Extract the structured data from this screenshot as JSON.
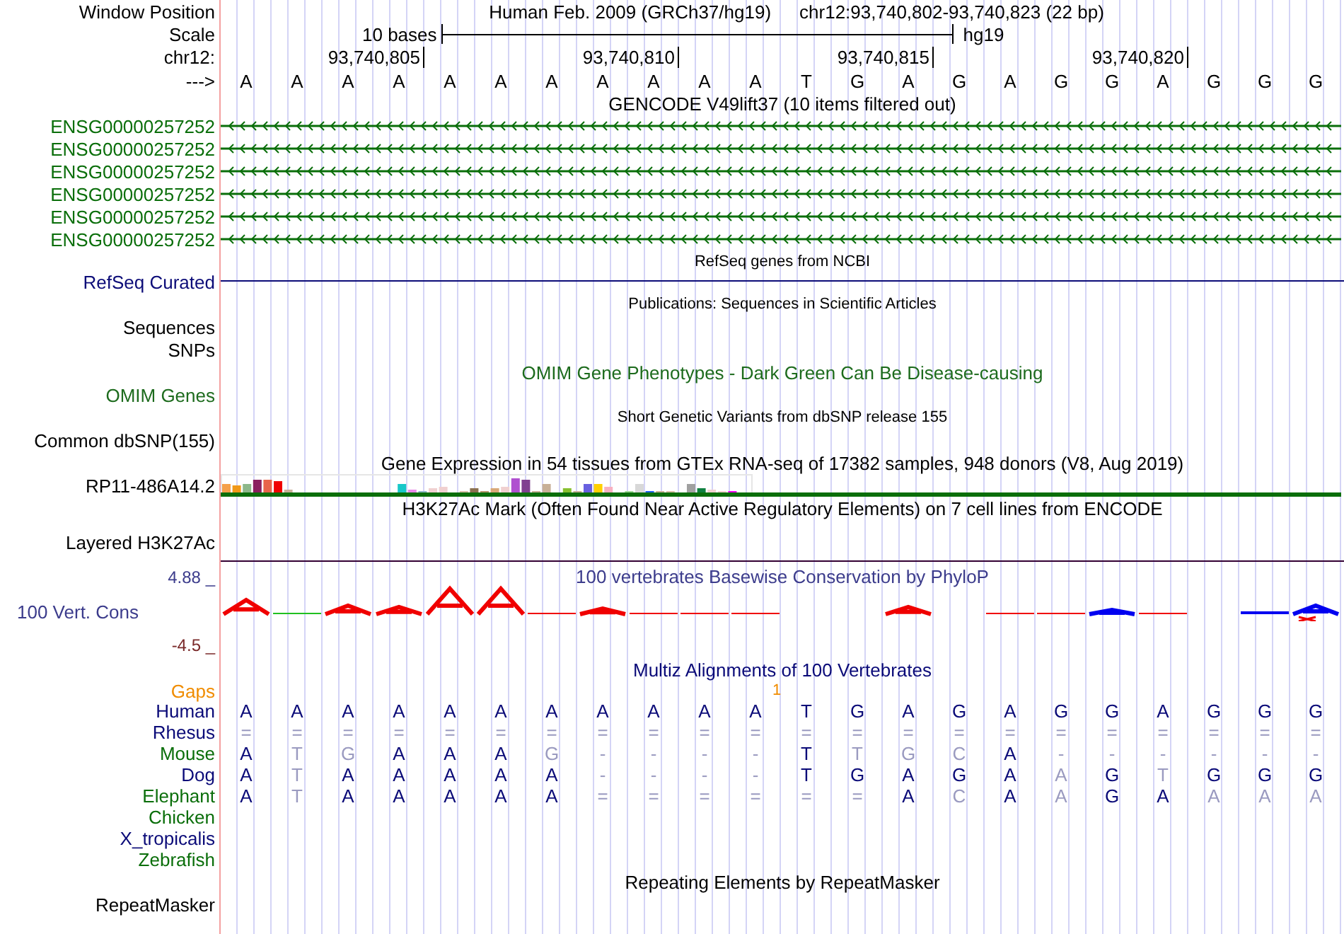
{
  "position": {
    "label": "Window Position",
    "assembly": "Human Feb. 2009 (GRCh37/hg19)",
    "range": "chr12:93,740,802-93,740,823 (22 bp)"
  },
  "scale": {
    "label": "Scale",
    "bar_label": "10 bases",
    "assembly": "hg19"
  },
  "ruler": {
    "label": "chr12:",
    "ticks": [
      "93,740,805",
      "93,740,810",
      "93,740,815",
      "93,740,820"
    ]
  },
  "sequence": {
    "label": "--->",
    "bases": [
      "A",
      "A",
      "A",
      "A",
      "A",
      "A",
      "A",
      "A",
      "A",
      "A",
      "A",
      "T",
      "G",
      "A",
      "G",
      "A",
      "G",
      "G",
      "A",
      "G",
      "G",
      "G"
    ]
  },
  "tracks": [
    {
      "kind": "genes",
      "title": {
        "text": "GENCODE V49lift37 (10 items filtered out)",
        "color": "#000000",
        "small": false
      },
      "color": "#0a6e0a",
      "rows": [
        "ENSG00000257252",
        "ENSG00000257252",
        "ENSG00000257252",
        "ENSG00000257252",
        "ENSG00000257252",
        "ENSG00000257252"
      ]
    },
    {
      "kind": "line",
      "title": {
        "text": "RefSeq genes from NCBI",
        "color": "#000000",
        "small": true
      },
      "color": "#0c0c78",
      "rows": [
        "RefSeq Curated"
      ]
    },
    {
      "kind": "labels",
      "title": {
        "text": "Publications: Sequences in Scientific Articles",
        "color": "#000000",
        "small": true
      },
      "color": "#000000",
      "rows": [
        "Sequences",
        "SNPs"
      ]
    },
    {
      "kind": "labels",
      "title": {
        "text": "OMIM Gene Phenotypes - Dark Green Can Be Disease-causing",
        "color": "#1d6b1d",
        "small": false
      },
      "color": "#1d6b1d",
      "rows": [
        "OMIM Genes"
      ]
    },
    {
      "kind": "labels",
      "title": {
        "text": "Short Genetic Variants from dbSNP release 155",
        "color": "#000000",
        "small": true
      },
      "color": "#000000",
      "rows": [
        "Common dbSNP(155)"
      ]
    },
    {
      "kind": "expression",
      "title": {
        "text": "Gene Expression in 54 tissues from GTEx RNA-seq of 17382 samples, 948 donors (V8, Aug 2019)",
        "color": "#000000",
        "small": false
      },
      "color": "#000000",
      "rows": [
        "RP11-486A14.2"
      ]
    },
    {
      "kind": "signal",
      "title": {
        "text": "H3K27Ac Mark (Often Found Near Active Regulatory Elements) on 7 cell lines from ENCODE",
        "color": "#000000",
        "small": false
      },
      "color": "#000000",
      "rows": [
        "Layered H3K27Ac"
      ]
    },
    {
      "kind": "conservation",
      "title": {
        "text": "100 vertebrates Basewise Conservation by PhyloP",
        "color": "#3c3c8c",
        "small": false
      },
      "color": "#3c3c8c",
      "rows": [
        "100 Vert. Cons"
      ],
      "max": {
        "text": "4.88 _",
        "color": "#3c3c8c"
      },
      "min": {
        "text": "-4.5 _",
        "color": "#7a2a2a"
      }
    },
    {
      "kind": "alignment",
      "title": {
        "text": "Multiz Alignments of 100 Vertebrates",
        "color": "#0a0a78",
        "small": false
      },
      "gaps": {
        "label": "Gaps",
        "mark": "1",
        "color": "#f08c00"
      },
      "species": [
        {
          "name": "Human",
          "color": "#0a0a78",
          "cells": [
            {
              "t": "A",
              "dim": false
            },
            {
              "t": "A",
              "dim": false
            },
            {
              "t": "A",
              "dim": false
            },
            {
              "t": "A",
              "dim": false
            },
            {
              "t": "A",
              "dim": false
            },
            {
              "t": "A",
              "dim": false
            },
            {
              "t": "A",
              "dim": false
            },
            {
              "t": "A",
              "dim": false
            },
            {
              "t": "A",
              "dim": false
            },
            {
              "t": "A",
              "dim": false
            },
            {
              "t": "A",
              "dim": false
            },
            {
              "t": "T",
              "dim": false
            },
            {
              "t": "G",
              "dim": false
            },
            {
              "t": "A",
              "dim": false
            },
            {
              "t": "G",
              "dim": false
            },
            {
              "t": "A",
              "dim": false
            },
            {
              "t": "G",
              "dim": false
            },
            {
              "t": "G",
              "dim": false
            },
            {
              "t": "A",
              "dim": false
            },
            {
              "t": "G",
              "dim": false
            },
            {
              "t": "G",
              "dim": false
            },
            {
              "t": "G",
              "dim": false
            }
          ]
        },
        {
          "name": "Rhesus",
          "color": "#0a0a78",
          "cells": [
            {
              "t": "=",
              "dim": true
            },
            {
              "t": "=",
              "dim": true
            },
            {
              "t": "=",
              "dim": true
            },
            {
              "t": "=",
              "dim": true
            },
            {
              "t": "=",
              "dim": true
            },
            {
              "t": "=",
              "dim": true
            },
            {
              "t": "=",
              "dim": true
            },
            {
              "t": "=",
              "dim": true
            },
            {
              "t": "=",
              "dim": true
            },
            {
              "t": "=",
              "dim": true
            },
            {
              "t": "=",
              "dim": true
            },
            {
              "t": "=",
              "dim": true
            },
            {
              "t": "=",
              "dim": true
            },
            {
              "t": "=",
              "dim": true
            },
            {
              "t": "=",
              "dim": true
            },
            {
              "t": "=",
              "dim": true
            },
            {
              "t": "=",
              "dim": true
            },
            {
              "t": "=",
              "dim": true
            },
            {
              "t": "=",
              "dim": true
            },
            {
              "t": "=",
              "dim": true
            },
            {
              "t": "=",
              "dim": true
            },
            {
              "t": "=",
              "dim": true
            }
          ]
        },
        {
          "name": "Mouse",
          "color": "#0a6e0a",
          "cells": [
            {
              "t": "A",
              "dim": false
            },
            {
              "t": "T",
              "dim": true
            },
            {
              "t": "G",
              "dim": true
            },
            {
              "t": "A",
              "dim": false
            },
            {
              "t": "A",
              "dim": false
            },
            {
              "t": "A",
              "dim": false
            },
            {
              "t": "G",
              "dim": true
            },
            {
              "t": "-",
              "dim": true
            },
            {
              "t": "-",
              "dim": true
            },
            {
              "t": "-",
              "dim": true
            },
            {
              "t": "-",
              "dim": true
            },
            {
              "t": "T",
              "dim": false
            },
            {
              "t": "T",
              "dim": true
            },
            {
              "t": "G",
              "dim": true
            },
            {
              "t": "C",
              "dim": true
            },
            {
              "t": "A",
              "dim": false
            },
            {
              "t": "-",
              "dim": true
            },
            {
              "t": "-",
              "dim": true
            },
            {
              "t": "-",
              "dim": true
            },
            {
              "t": "-",
              "dim": true
            },
            {
              "t": "-",
              "dim": true
            },
            {
              "t": "-",
              "dim": true
            }
          ]
        },
        {
          "name": "Dog",
          "color": "#0a0a78",
          "cells": [
            {
              "t": "A",
              "dim": false
            },
            {
              "t": "T",
              "dim": true
            },
            {
              "t": "A",
              "dim": false
            },
            {
              "t": "A",
              "dim": false
            },
            {
              "t": "A",
              "dim": false
            },
            {
              "t": "A",
              "dim": false
            },
            {
              "t": "A",
              "dim": false
            },
            {
              "t": "-",
              "dim": true
            },
            {
              "t": "-",
              "dim": true
            },
            {
              "t": "-",
              "dim": true
            },
            {
              "t": "-",
              "dim": true
            },
            {
              "t": "T",
              "dim": false
            },
            {
              "t": "G",
              "dim": false
            },
            {
              "t": "A",
              "dim": false
            },
            {
              "t": "G",
              "dim": false
            },
            {
              "t": "A",
              "dim": false
            },
            {
              "t": "A",
              "dim": true
            },
            {
              "t": "G",
              "dim": false
            },
            {
              "t": "T",
              "dim": true
            },
            {
              "t": "G",
              "dim": false
            },
            {
              "t": "G",
              "dim": false
            },
            {
              "t": "G",
              "dim": false
            }
          ]
        },
        {
          "name": "Elephant",
          "color": "#0a6e0a",
          "cells": [
            {
              "t": "A",
              "dim": false
            },
            {
              "t": "T",
              "dim": true
            },
            {
              "t": "A",
              "dim": false
            },
            {
              "t": "A",
              "dim": false
            },
            {
              "t": "A",
              "dim": false
            },
            {
              "t": "A",
              "dim": false
            },
            {
              "t": "A",
              "dim": false
            },
            {
              "t": "=",
              "dim": true
            },
            {
              "t": "=",
              "dim": true
            },
            {
              "t": "=",
              "dim": true
            },
            {
              "t": "=",
              "dim": true
            },
            {
              "t": "=",
              "dim": true
            },
            {
              "t": "=",
              "dim": true
            },
            {
              "t": "A",
              "dim": false
            },
            {
              "t": "C",
              "dim": true
            },
            {
              "t": "A",
              "dim": false
            },
            {
              "t": "A",
              "dim": true
            },
            {
              "t": "G",
              "dim": false
            },
            {
              "t": "A",
              "dim": false
            },
            {
              "t": "A",
              "dim": true
            },
            {
              "t": "A",
              "dim": true
            },
            {
              "t": "A",
              "dim": true
            }
          ]
        },
        {
          "name": "Chicken",
          "color": "#0a6e0a"
        },
        {
          "name": "X_tropicalis",
          "color": "#0a0a78"
        },
        {
          "name": "Zebrafish",
          "color": "#0a6e0a"
        }
      ]
    },
    {
      "kind": "labels",
      "title": {
        "text": "Repeating Elements by RepeatMasker",
        "color": "#000000",
        "small": false
      },
      "color": "#000000",
      "rows": [
        "RepeatMasker"
      ]
    }
  ]
}
